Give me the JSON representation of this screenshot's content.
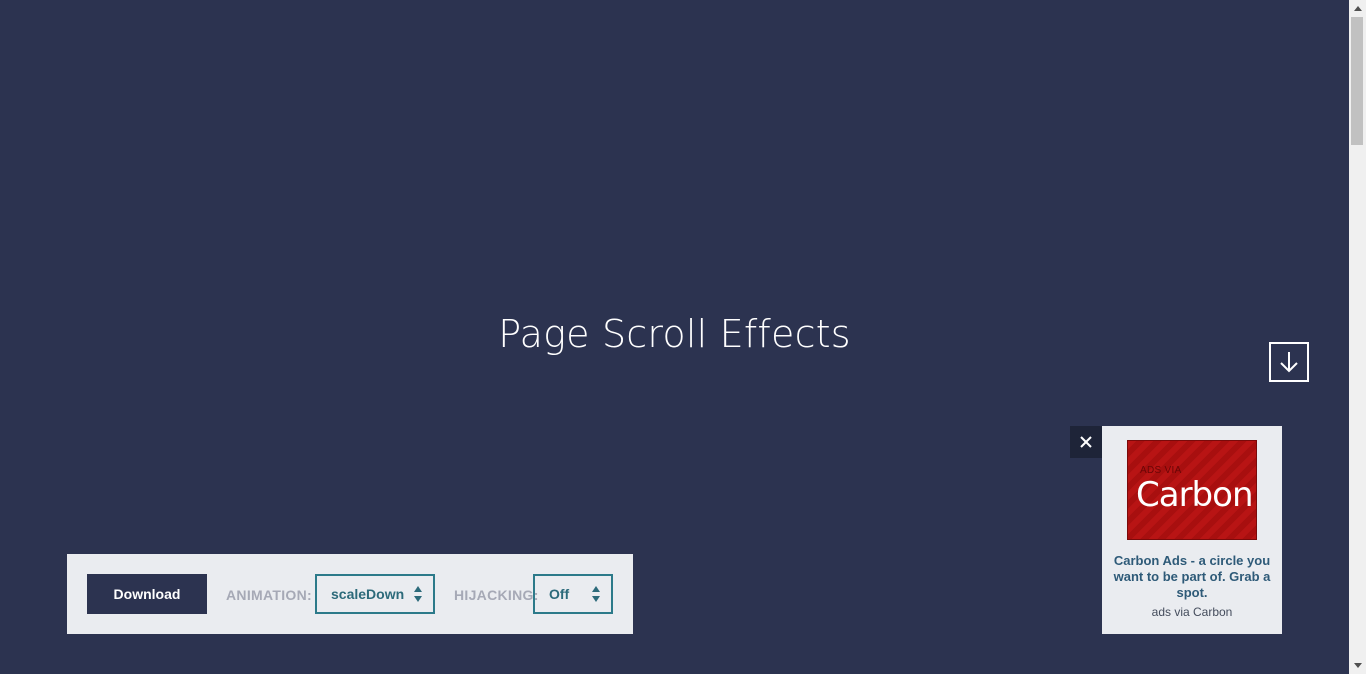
{
  "hero": {
    "title": "Page Scroll Effects"
  },
  "controls": {
    "download_label": "Download",
    "animation_label": "ANIMATION:",
    "animation_value": "scaleDown",
    "hijacking_label": "HIJACKING:",
    "hijacking_value": "Off"
  },
  "ad": {
    "close_glyph": "✕",
    "image_small_text": "ADS VIA",
    "image_brand_text": "Carbon",
    "text": "Carbon Ads - a circle you want to be part of. Grab a spot.",
    "via_text": "ads via Carbon"
  },
  "icons": {
    "next_section": "arrow-down-icon",
    "select_arrows": "up-down-arrows-icon",
    "ad_close": "close-icon"
  },
  "colors": {
    "background": "#2c3350",
    "panel": "#eaecf0",
    "accent": "#2c7a8a",
    "ad_red": "#b81414"
  }
}
